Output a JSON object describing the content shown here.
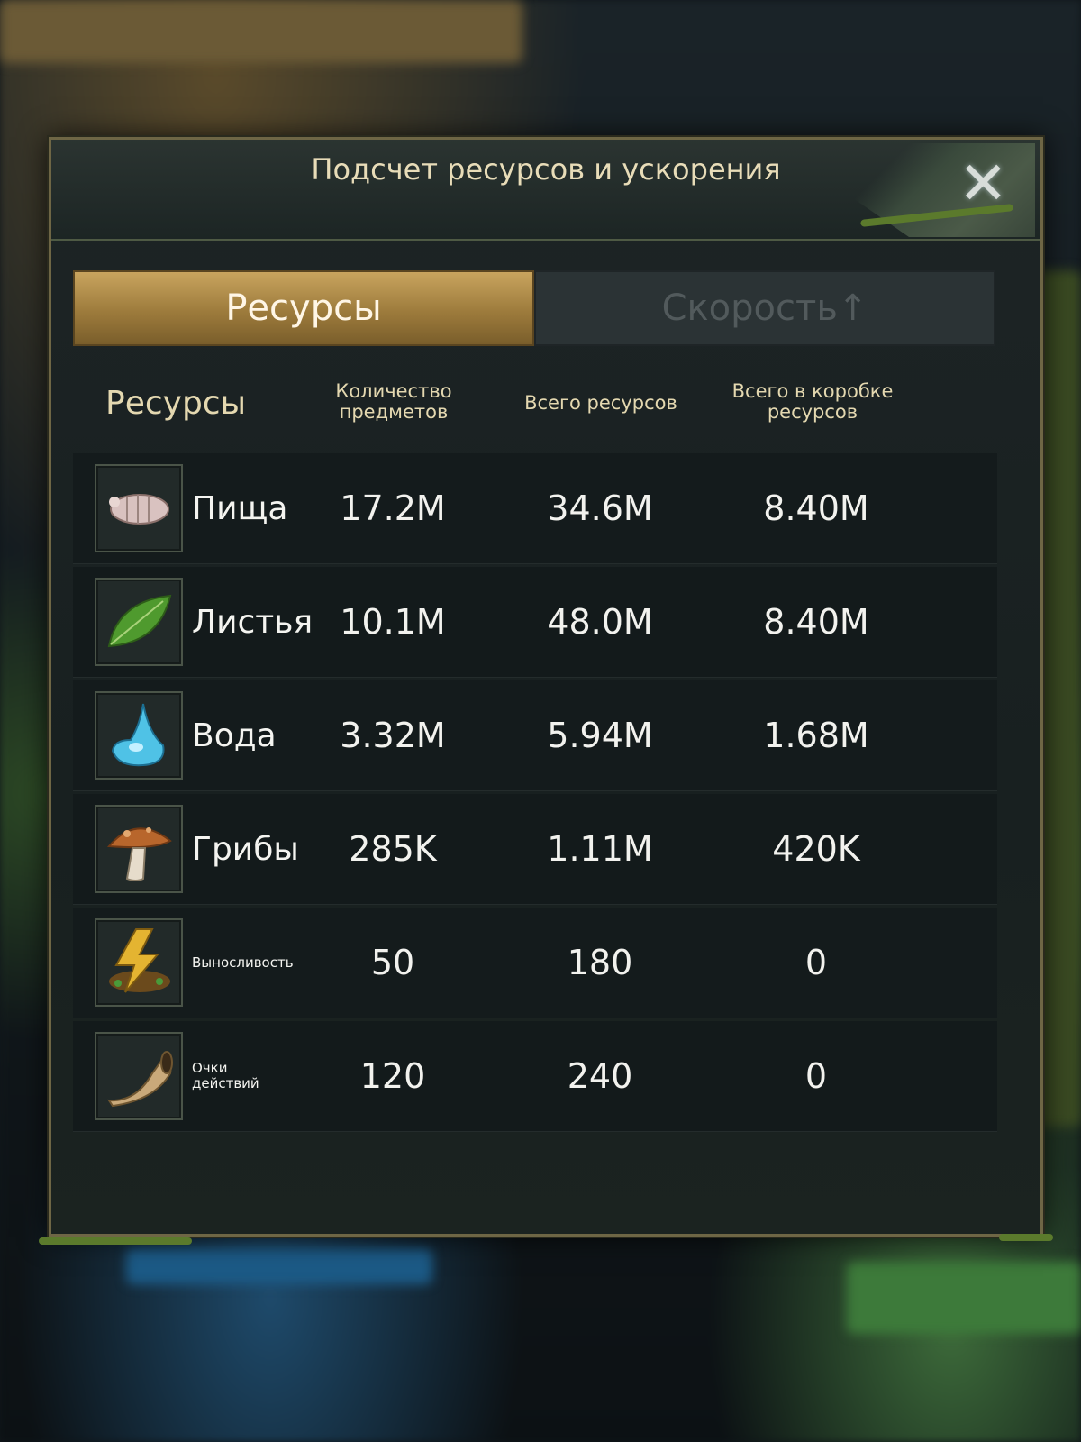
{
  "dialog": {
    "title": "Подсчет ресурсов и ускорения",
    "close_icon": "close-x-icon"
  },
  "tabs": [
    {
      "label": "Ресурсы",
      "active": true
    },
    {
      "label": "Скорость↑",
      "active": false
    }
  ],
  "columns": {
    "resource": "Ресурсы",
    "item_count": "Количество предметов",
    "total_resources": "Всего ресурсов",
    "total_in_box": "Всего в коробке ресурсов"
  },
  "rows": [
    {
      "icon": "food-grub-icon",
      "name": "Пища",
      "item_count": "17.2M",
      "total": "34.6M",
      "box_total": "8.40M"
    },
    {
      "icon": "leaf-icon",
      "name": "Листья",
      "item_count": "10.1M",
      "total": "48.0M",
      "box_total": "8.40M"
    },
    {
      "icon": "water-drop-icon",
      "name": "Вода",
      "item_count": "3.32M",
      "total": "5.94M",
      "box_total": "1.68M"
    },
    {
      "icon": "mushroom-icon",
      "name": "Грибы",
      "item_count": "285K",
      "total": "1.11M",
      "box_total": "420K"
    },
    {
      "icon": "stamina-lightning-icon",
      "name": "Выносливость",
      "item_count": "50",
      "total": "180",
      "box_total": "0"
    },
    {
      "icon": "horn-icon",
      "name": "Очки действий",
      "item_count": "120",
      "total": "240",
      "box_total": "0"
    }
  ],
  "colors": {
    "accent_gold": "#c9a45e",
    "panel_bg": "#1d2425",
    "text_header": "#e4d8b0"
  }
}
